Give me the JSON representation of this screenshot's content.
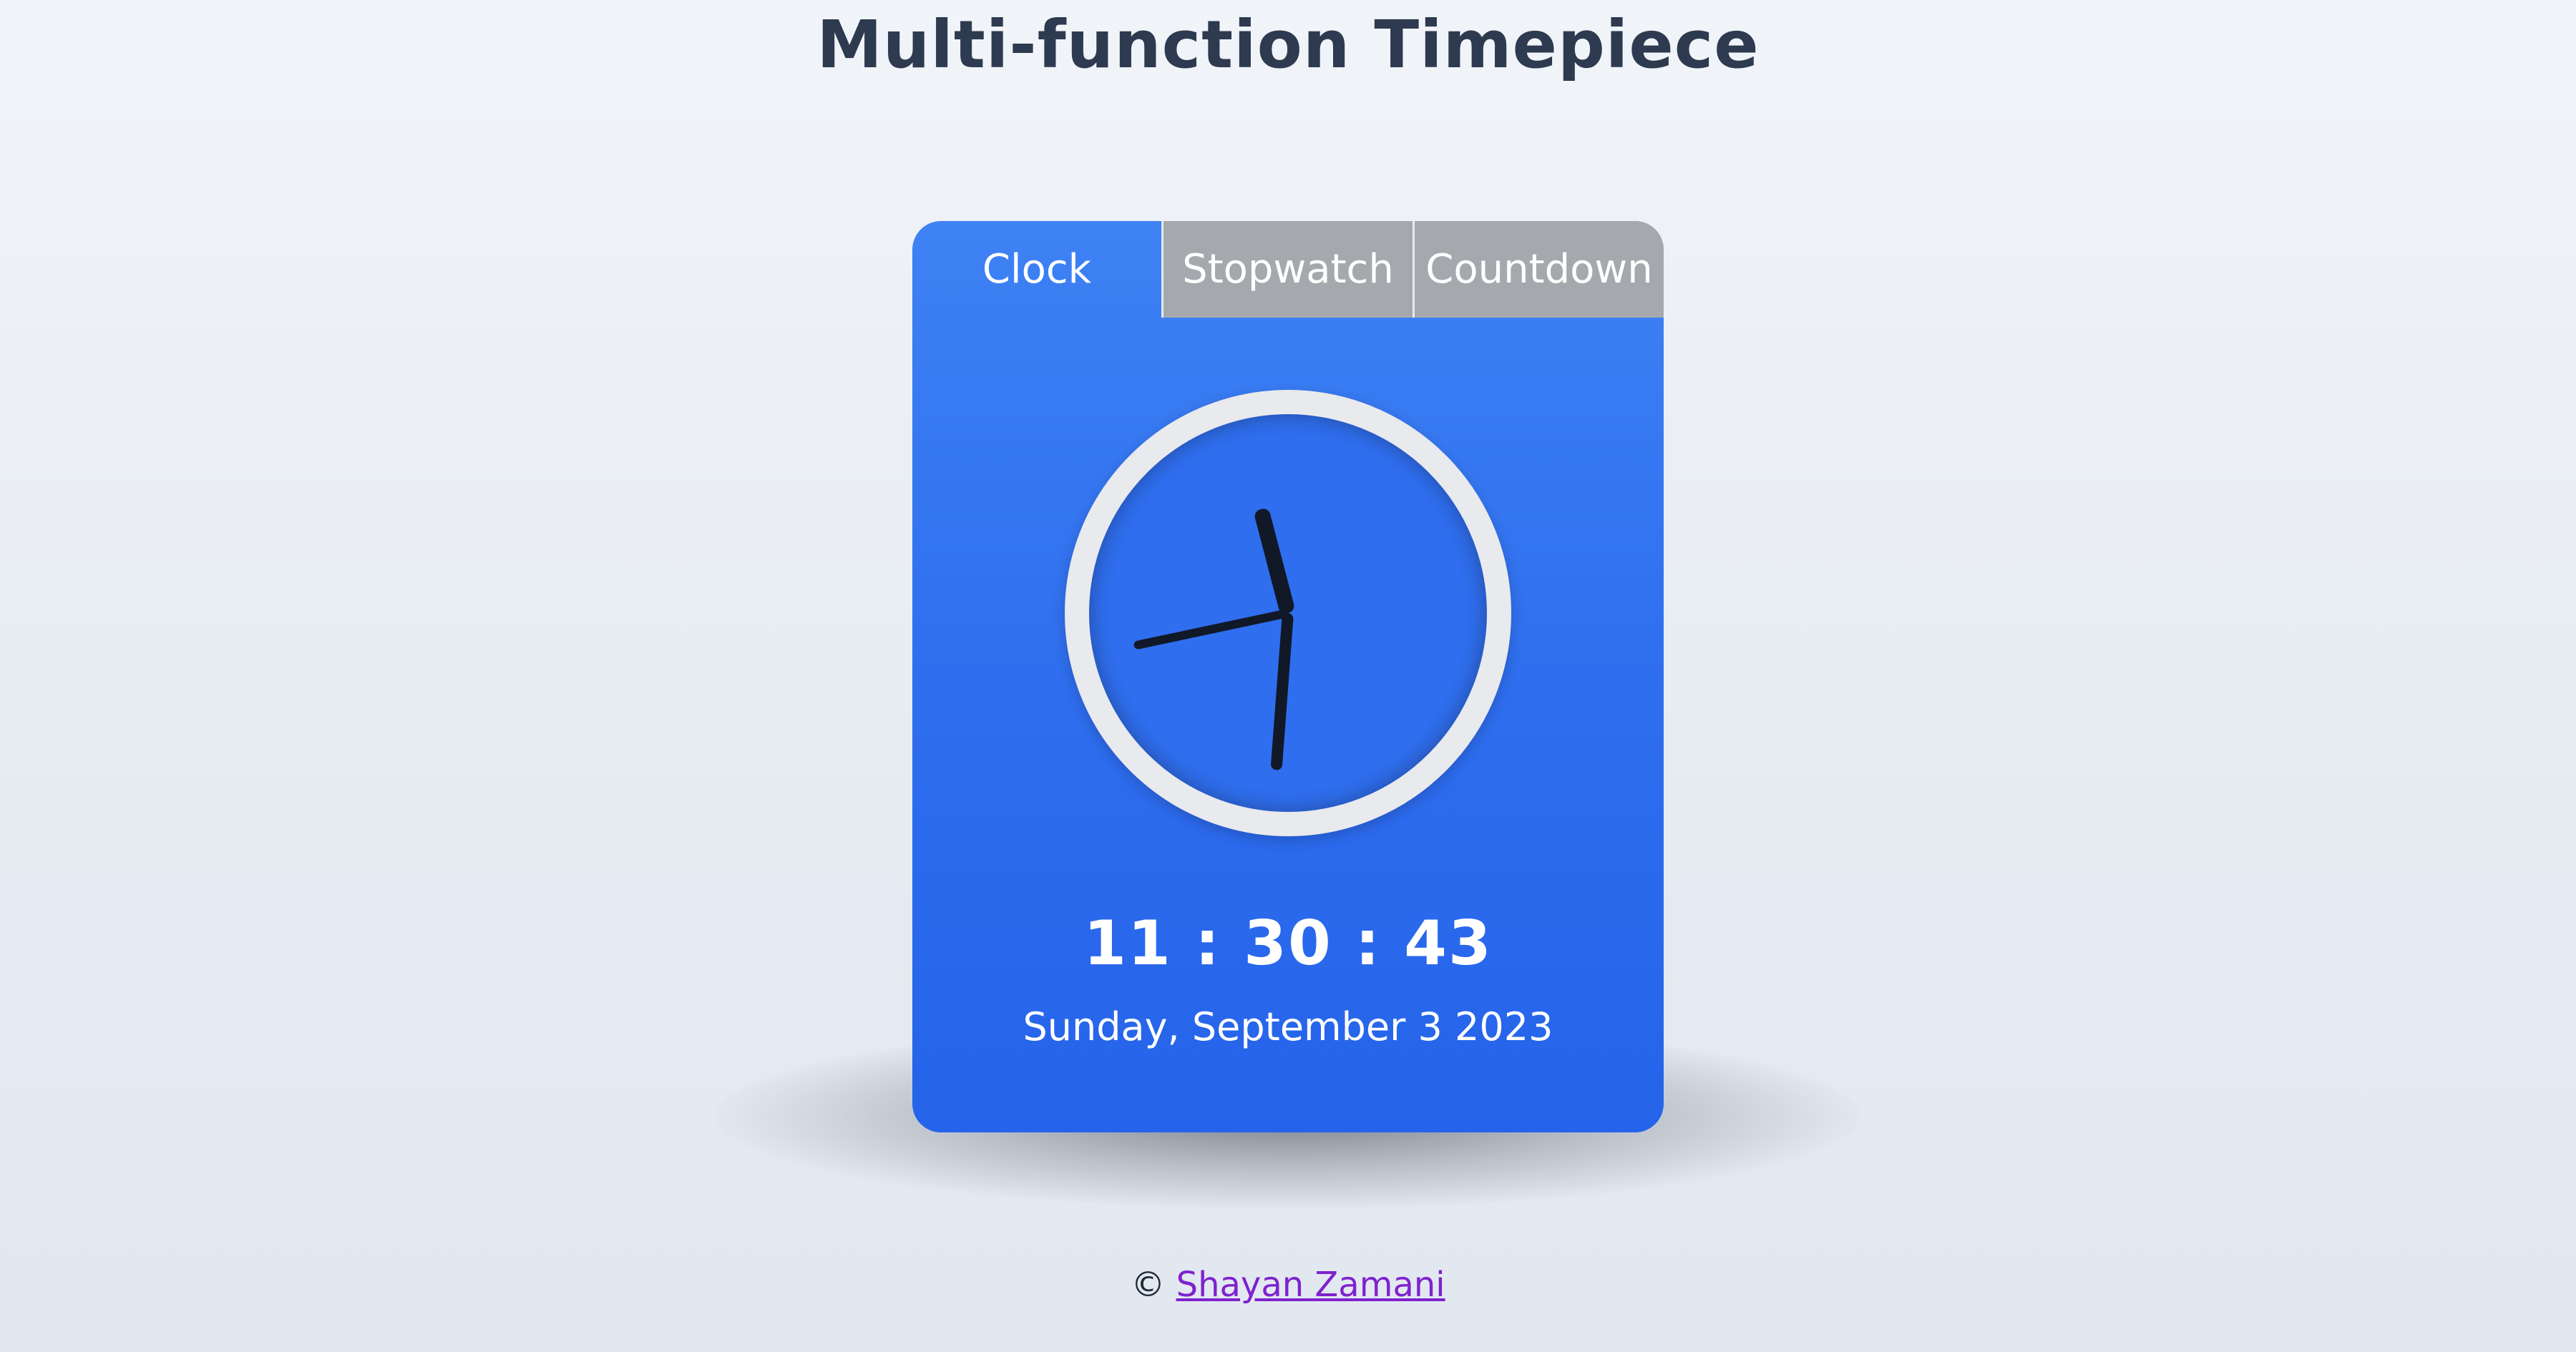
{
  "page": {
    "title": "Multi-function Timepiece"
  },
  "tabs": [
    {
      "label": "Clock",
      "active": true
    },
    {
      "label": "Stopwatch",
      "active": false
    },
    {
      "label": "Countdown",
      "active": false
    }
  ],
  "clock": {
    "hours": 11,
    "minutes": 30,
    "seconds": 43,
    "time_display": "11 : 30 : 43",
    "date_display": "Sunday, September 3 2023"
  },
  "footer": {
    "copyright_symbol": "©",
    "author_link": "Shayan Zamani"
  },
  "colors": {
    "accent": "#2f6eee",
    "inactive_tab": "#a5a9ad",
    "title": "#2d3a4f",
    "link": "#7e22ce"
  }
}
